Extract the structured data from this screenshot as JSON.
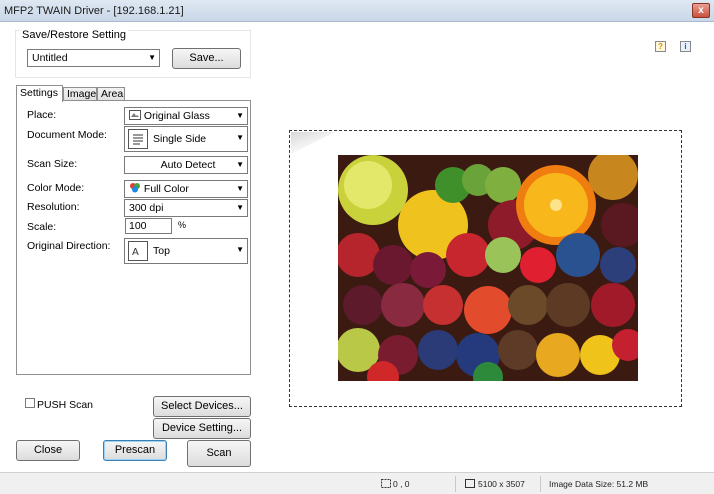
{
  "window": {
    "title": "MFP2 TWAIN Driver - [192.168.1.21]",
    "close_glyph": "x"
  },
  "save_restore": {
    "label": "Save/Restore Setting",
    "preset_value": "Untitled",
    "save_label": "Save..."
  },
  "tabs": [
    {
      "label": "Settings",
      "active": true
    },
    {
      "label": "Image",
      "active": false
    },
    {
      "label": "Area",
      "active": false
    }
  ],
  "settings": {
    "place_label": "Place:",
    "place_value": "Original Glass",
    "document_mode_label": "Document Mode:",
    "document_mode_value": "Single Side",
    "scan_size_label": "Scan Size:",
    "scan_size_value": "Auto Detect",
    "color_mode_label": "Color Mode:",
    "color_mode_value": "Full Color",
    "resolution_label": "Resolution:",
    "resolution_value": "300 dpi",
    "scale_label": "Scale:",
    "scale_value": "100",
    "scale_unit": "%",
    "original_direction_label": "Original Direction:",
    "original_direction_value": "Top"
  },
  "bottom": {
    "push_scan_label": "PUSH Scan",
    "push_scan_checked": false,
    "select_devices_label": "Select Devices...",
    "device_setting_label": "Device Setting...",
    "close_label": "Close",
    "prescan_label": "Prescan",
    "scan_label": "Scan"
  },
  "help_icons": {
    "help": "?",
    "info": "i"
  },
  "status": {
    "coords": "0 , 0",
    "dimensions": "5100 x 3507",
    "data_size": "Image Data Size: 51.2 MB"
  },
  "colors": {
    "title_bar": "#c9d7e8",
    "close_button": "#c9503c",
    "default_button_border": "#3c7fb1"
  }
}
